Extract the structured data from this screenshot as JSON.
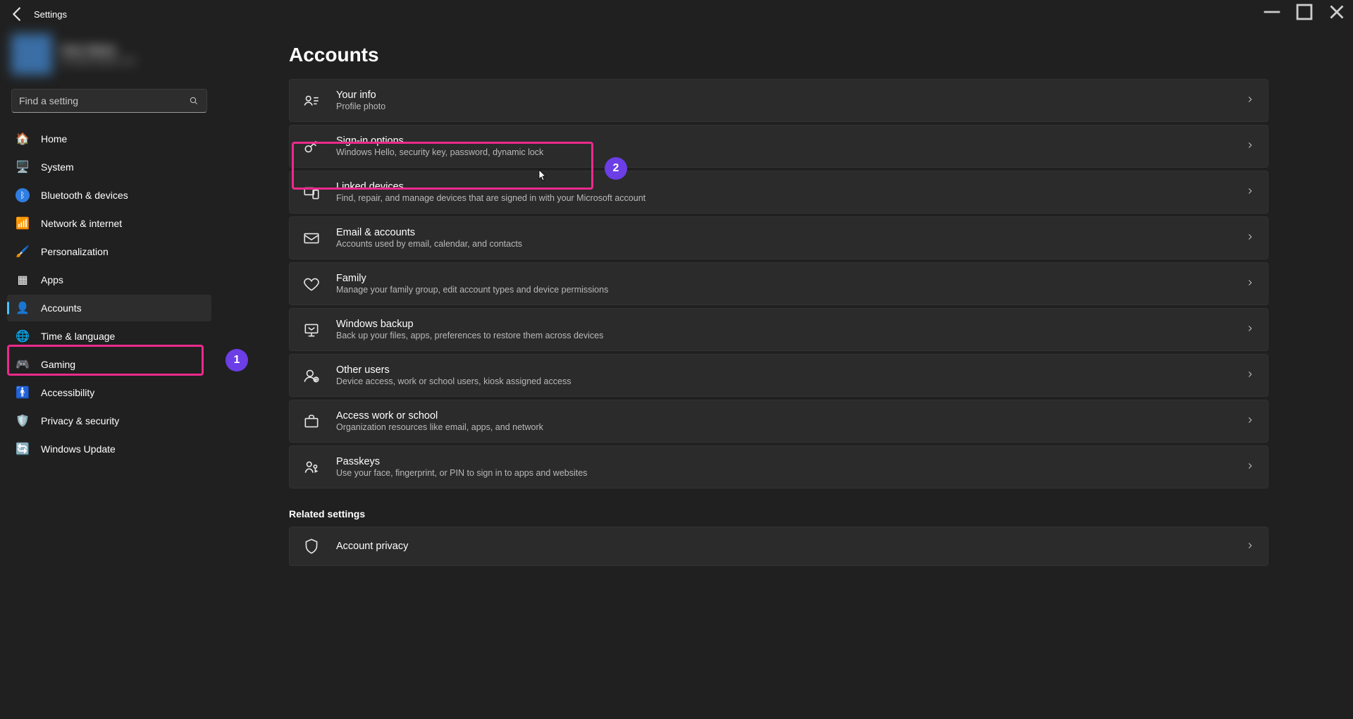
{
  "window": {
    "title": "Settings"
  },
  "search": {
    "placeholder": "Find a setting"
  },
  "nav": [
    {
      "label": "Home"
    },
    {
      "label": "System"
    },
    {
      "label": "Bluetooth & devices"
    },
    {
      "label": "Network & internet"
    },
    {
      "label": "Personalization"
    },
    {
      "label": "Apps"
    },
    {
      "label": "Accounts"
    },
    {
      "label": "Time & language"
    },
    {
      "label": "Gaming"
    },
    {
      "label": "Accessibility"
    },
    {
      "label": "Privacy & security"
    },
    {
      "label": "Windows Update"
    }
  ],
  "page": {
    "title": "Accounts",
    "related_header": "Related settings",
    "cards": [
      {
        "title": "Your info",
        "sub": "Profile photo"
      },
      {
        "title": "Sign-in options",
        "sub": "Windows Hello, security key, password, dynamic lock"
      },
      {
        "title": "Linked devices",
        "sub": "Find, repair, and manage devices that are signed in with your Microsoft account"
      },
      {
        "title": "Email & accounts",
        "sub": "Accounts used by email, calendar, and contacts"
      },
      {
        "title": "Family",
        "sub": "Manage your family group, edit account types and device permissions"
      },
      {
        "title": "Windows backup",
        "sub": "Back up your files, apps, preferences to restore them across devices"
      },
      {
        "title": "Other users",
        "sub": "Device access, work or school users, kiosk assigned access"
      },
      {
        "title": "Access work or school",
        "sub": "Organization resources like email, apps, and network"
      },
      {
        "title": "Passkeys",
        "sub": "Use your face, fingerprint, or PIN to sign in to apps and websites"
      }
    ],
    "related": [
      {
        "title": "Account privacy",
        "sub": ""
      }
    ]
  },
  "annotations": {
    "step1": "1",
    "step2": "2"
  }
}
